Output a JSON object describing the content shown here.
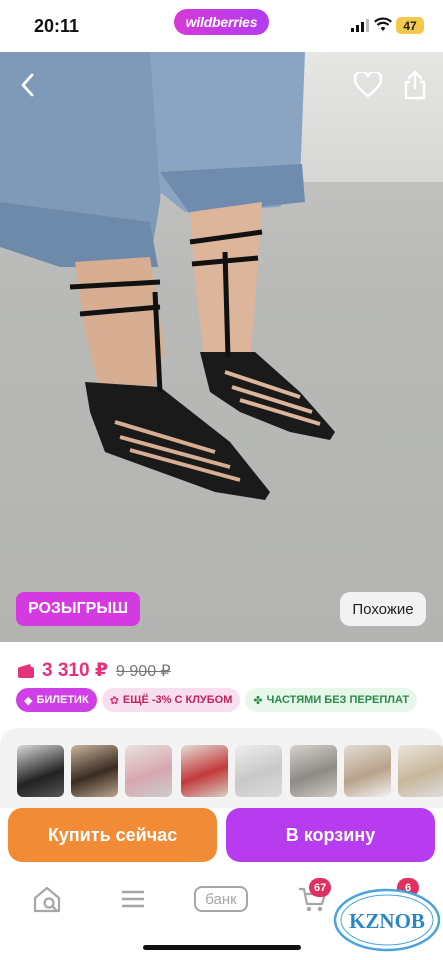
{
  "status_bar": {
    "time": "20:11",
    "battery": "47"
  },
  "brand": "wildberries",
  "hero": {
    "raffle_label": "РОЗЫГРЫШ",
    "similar_label": "Похожие"
  },
  "price": {
    "current": "3 310 ₽",
    "old": "9 900 ₽"
  },
  "chips": [
    {
      "label": "БИЛЕТИК",
      "icon": "ticket-icon"
    },
    {
      "label": "ЕЩЁ -3% С КЛУБОМ",
      "icon": "club-icon"
    },
    {
      "label": "ЧАСТЯМИ БЕЗ ПЕРЕПЛАТ",
      "icon": "clover-icon"
    }
  ],
  "thumbnails": [
    {
      "label": "black-sandals-pose"
    },
    {
      "label": "black-sandals-side"
    },
    {
      "label": "pink-sandals"
    },
    {
      "label": "red-sandals"
    },
    {
      "label": "silver-heels"
    },
    {
      "label": "grey-heels"
    },
    {
      "label": "white-sandals"
    },
    {
      "label": "beige-sandals"
    }
  ],
  "actions": {
    "buy_now": "Купить сейчас",
    "add_to_cart": "В корзину"
  },
  "tabbar": {
    "bank": "банк",
    "cart_count": "67",
    "profile_count": "6"
  },
  "watermark": "KZNOB",
  "colors": {
    "accent_purple": "#b73cf0",
    "accent_orange": "#f28b35",
    "price_pink": "#e5327a"
  }
}
